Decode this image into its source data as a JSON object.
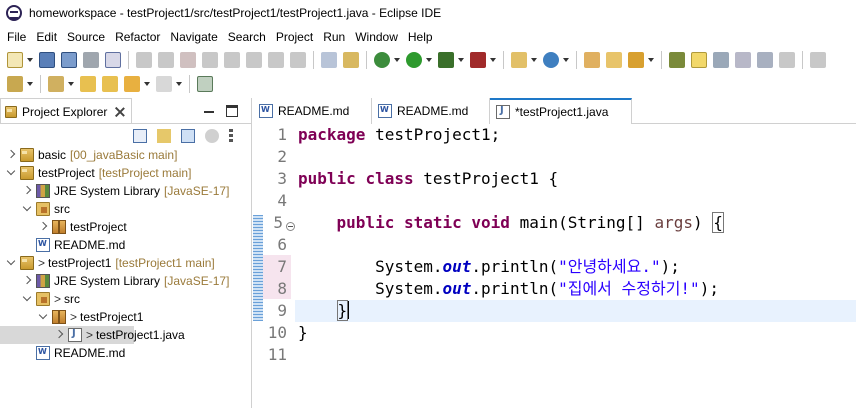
{
  "window": {
    "title": "homeworkspace - testProject1/src/testProject1/testProject1.java - Eclipse IDE"
  },
  "menu": [
    "File",
    "Edit",
    "Source",
    "Refactor",
    "Navigate",
    "Search",
    "Project",
    "Run",
    "Window",
    "Help"
  ],
  "project_explorer": {
    "title": "Project Explorer",
    "tree": [
      {
        "label": "basic",
        "decor": "[00_javaBasic main]"
      },
      {
        "label": "testProject",
        "decor": "[testProject main]"
      },
      {
        "label": "JRE System Library",
        "decor": "[JavaSE-17]"
      },
      {
        "label": "src",
        "decor": ""
      },
      {
        "label": "testProject",
        "decor": ""
      },
      {
        "label": "README.md",
        "decor": ""
      },
      {
        "label": "testProject1",
        "decor": "[testProject1 main]"
      },
      {
        "label": "JRE System Library",
        "decor": "[JavaSE-17]"
      },
      {
        "label": "src",
        "decor": ""
      },
      {
        "label": "testProject1",
        "decor": ""
      },
      {
        "label": "testProject1.java",
        "decor": ""
      },
      {
        "label": "README.md",
        "decor": ""
      }
    ],
    "dirty_marker": ">"
  },
  "editor": {
    "tabs": [
      "README.md",
      "README.md",
      "*testProject1.java"
    ],
    "line_numbers": [
      "1",
      "2",
      "3",
      "4",
      "5",
      "6",
      "7",
      "8",
      "9",
      "10",
      "11"
    ],
    "code": {
      "l1_kw": "package",
      "l1_rest": " testProject1;",
      "l3_kw1": "public",
      "l3_kw2": "class",
      "l3_rest": " testProject1 {",
      "l5_kw1": "public",
      "l5_kw2": "static",
      "l5_kw3": "void",
      "l5_rest": " main(String[] ",
      "l5_param": "args",
      "l5_close": ") ",
      "l5_brace": "{",
      "l7_a": "System.",
      "l7_field": "out",
      "l7_b": ".println(",
      "l7_str": "\"안녕하세요.\"",
      "l7_c": ");",
      "l8_a": "System.",
      "l8_field": "out",
      "l8_b": ".println(",
      "l8_str": "\"집에서 수정하기!\"",
      "l8_c": ");",
      "l9": "}",
      "l10": "}"
    }
  }
}
